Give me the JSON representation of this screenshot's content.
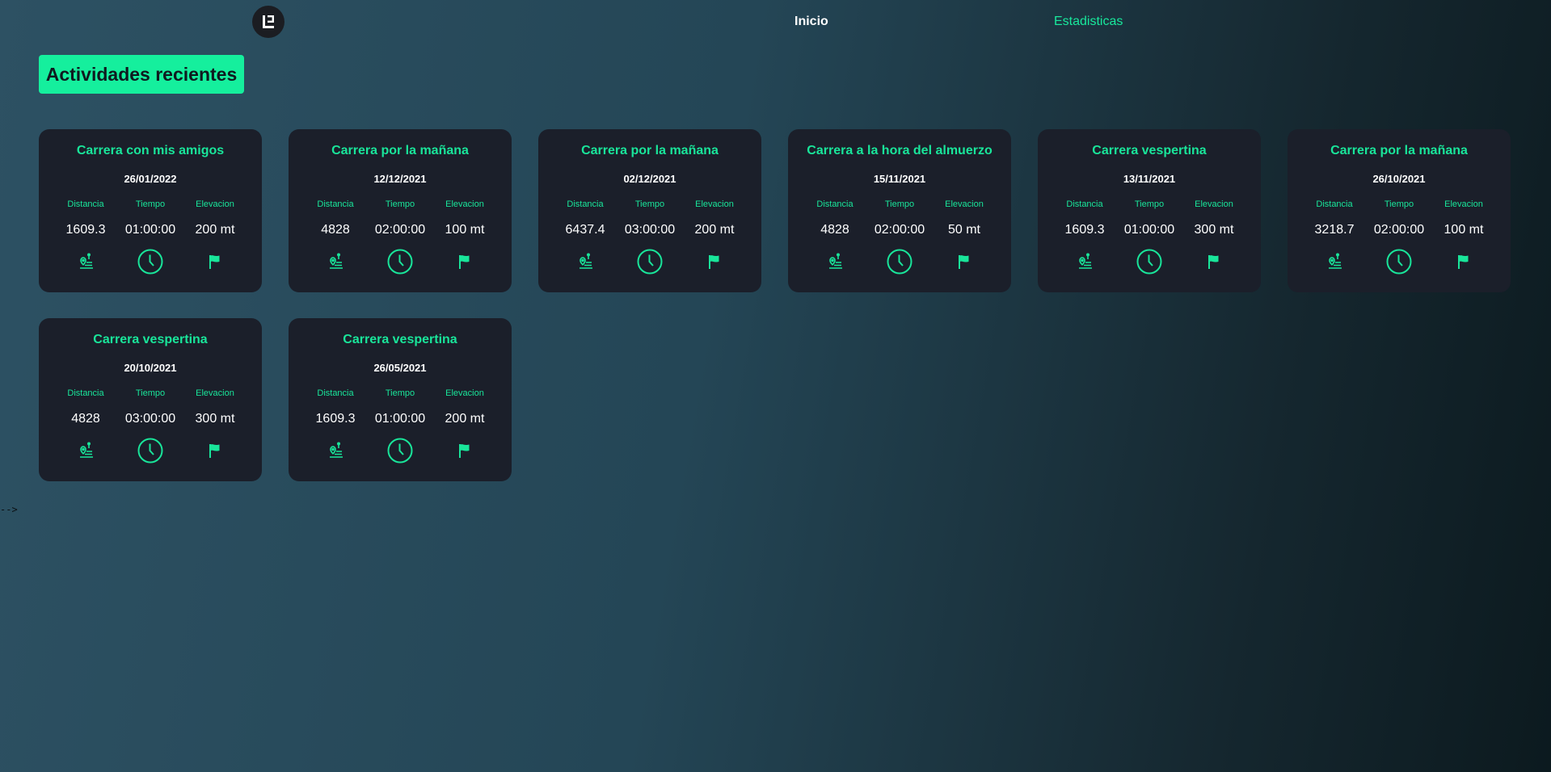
{
  "nav": {
    "logo_text": "E",
    "home_label": "Inicio",
    "stats_label": "Estadisticas"
  },
  "section_title": "Actividades recientes",
  "labels": {
    "distance": "Distancia",
    "time": "Tiempo",
    "elevation": "Elevacion"
  },
  "icons": [
    "route-pin-icon",
    "clock-icon",
    "flag-icon"
  ],
  "colors": {
    "accent": "#19e59a",
    "card_bg": "#1b1f2a",
    "title_bg": "#15ef9d"
  },
  "activities": [
    {
      "title": "Carrera con mis amigos",
      "date": "26/01/2022",
      "distance": "1609.3",
      "time": "01:00:00",
      "elevation": "200 mt"
    },
    {
      "title": "Carrera por la mañana",
      "date": "12/12/2021",
      "distance": "4828",
      "time": "02:00:00",
      "elevation": "100 mt"
    },
    {
      "title": "Carrera por la mañana",
      "date": "02/12/2021",
      "distance": "6437.4",
      "time": "03:00:00",
      "elevation": "200 mt"
    },
    {
      "title": "Carrera a la hora del almuerzo",
      "date": "15/11/2021",
      "distance": "4828",
      "time": "02:00:00",
      "elevation": "50 mt"
    },
    {
      "title": "Carrera vespertina",
      "date": "13/11/2021",
      "distance": "1609.3",
      "time": "01:00:00",
      "elevation": "300 mt"
    },
    {
      "title": "Carrera por la mañana",
      "date": "26/10/2021",
      "distance": "3218.7",
      "time": "02:00:00",
      "elevation": "100 mt"
    },
    {
      "title": "Carrera vespertina",
      "date": "20/10/2021",
      "distance": "4828",
      "time": "03:00:00",
      "elevation": "300 mt"
    },
    {
      "title": "Carrera vespertina",
      "date": "26/05/2021",
      "distance": "1609.3",
      "time": "01:00:00",
      "elevation": "200 mt"
    }
  ],
  "stray_text": "-->"
}
